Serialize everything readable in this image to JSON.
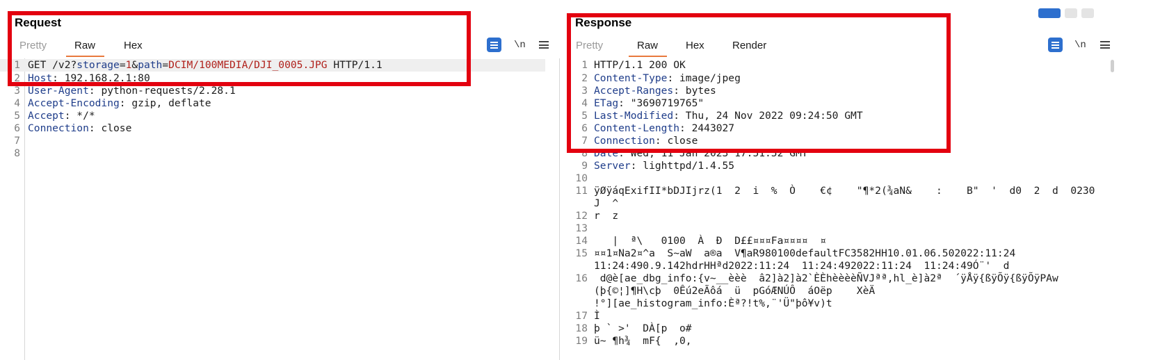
{
  "request": {
    "title": "Request",
    "tabs": [
      "Pretty",
      "Raw",
      "Hex"
    ],
    "active_tab": "Raw",
    "toolbar": {
      "newline_label": "\\n"
    },
    "lines": [
      {
        "n": "1",
        "method_path": "GET /v2?",
        "p1_name": "storage",
        "eq1": "=",
        "p1_val": "1",
        "amp": "&",
        "p2_name": "path",
        "eq2": "=",
        "p2_val": "DCIM/100MEDIA/DJI_0005.JPG",
        "proto": " HTTP/1.1"
      },
      {
        "n": "2",
        "name": "Host",
        "value": ": 192.168.2.1:80"
      },
      {
        "n": "3",
        "name": "User-Agent",
        "value": ": python-requests/2.28.1"
      },
      {
        "n": "4",
        "name": "Accept-Encoding",
        "value": ": gzip, deflate"
      },
      {
        "n": "5",
        "name": "Accept",
        "value": ": */*"
      },
      {
        "n": "6",
        "name": "Connection",
        "value": ": close"
      },
      {
        "n": "7",
        "text": ""
      },
      {
        "n": "8",
        "text": ""
      }
    ]
  },
  "response": {
    "title": "Response",
    "tabs": [
      "Pretty",
      "Raw",
      "Hex",
      "Render"
    ],
    "active_tab": "Raw",
    "toolbar": {
      "newline_label": "\\n"
    },
    "lines": [
      {
        "n": "1",
        "text": "HTTP/1.1 200 OK"
      },
      {
        "n": "2",
        "name": "Content-Type",
        "value": ": image/jpeg"
      },
      {
        "n": "3",
        "name": "Accept-Ranges",
        "value": ": bytes"
      },
      {
        "n": "4",
        "name": "ETag",
        "value": ": \"3690719765\""
      },
      {
        "n": "5",
        "name": "Last-Modified",
        "value": ": Thu, 24 Nov 2022 09:24:50 GMT"
      },
      {
        "n": "6",
        "name": "Content-Length",
        "value": ": 2443027"
      },
      {
        "n": "7",
        "name": "Connection",
        "value": ": close"
      },
      {
        "n": "8",
        "name": "Date",
        "value": ": Wed, 11 Jan 2023 17:51:52 GMT"
      },
      {
        "n": "9",
        "name": "Server",
        "value": ": lighttpd/1.4.55"
      },
      {
        "n": "10",
        "text": ""
      },
      {
        "n": "11",
        "text": "ÿØÿáqExifII*bDJIjrz(1  2  i  %  Ò    €¢    \"¶*2(¾aN&    :    B\"  '  d0  2  d  0230"
      },
      {
        "n": "",
        "text": "J  ^"
      },
      {
        "n": "12",
        "text": "r  z"
      },
      {
        "n": "13",
        "text": ""
      },
      {
        "n": "14",
        "text": "   |  ª\\   0100  À  Ð  D££¤¤¤Fa¤¤¤¤  ¤"
      },
      {
        "n": "15",
        "text": "¤¤1¤Na2¤^a  S~aW  a®a  V¶aR980100defaultFC3582HH10.01.06.502022:11:24"
      },
      {
        "n": "",
        "text": "11:24:490.9.142hdrHHªd2022:11:24  11:24:492022:11:24  11:24:49Ó¨'  d"
      },
      {
        "n": "16",
        "text": " d@è[ae_dbg_info:{v~__èèè  â2]à2]à2`ÈÈhèèèèÑVJªª,hl_è]à2ª  ´ÿÅÿ{ßÿÕÿ{ßÿÕÿPAw"
      },
      {
        "n": "",
        "text": "(þ{©¦]¶H\\cþ  0Êú2eÃôá  ü  pGóÆNÚÔ  áOëp    XèÄ"
      },
      {
        "n": "",
        "text": "!°][ae_histogram_info:Èª?!t%,¨'Ü\"þô¥v)t"
      },
      {
        "n": "17",
        "text": "Ì"
      },
      {
        "n": "18",
        "text": "þ ` >'  DÀ[p  o#"
      },
      {
        "n": "19",
        "text": "ü~ ¶h¾  mF{  ,0,"
      }
    ]
  },
  "colors": {
    "annotation_box": "#e3000f",
    "active_tab_underline": "#e8793d",
    "wrap_button": "#2d6fce",
    "header_name": "#1f3d8a",
    "param_value": "#b0201b"
  },
  "icons": [
    "wrap-lines-icon",
    "newline-toggle-icon",
    "hamburger-menu-icon"
  ]
}
